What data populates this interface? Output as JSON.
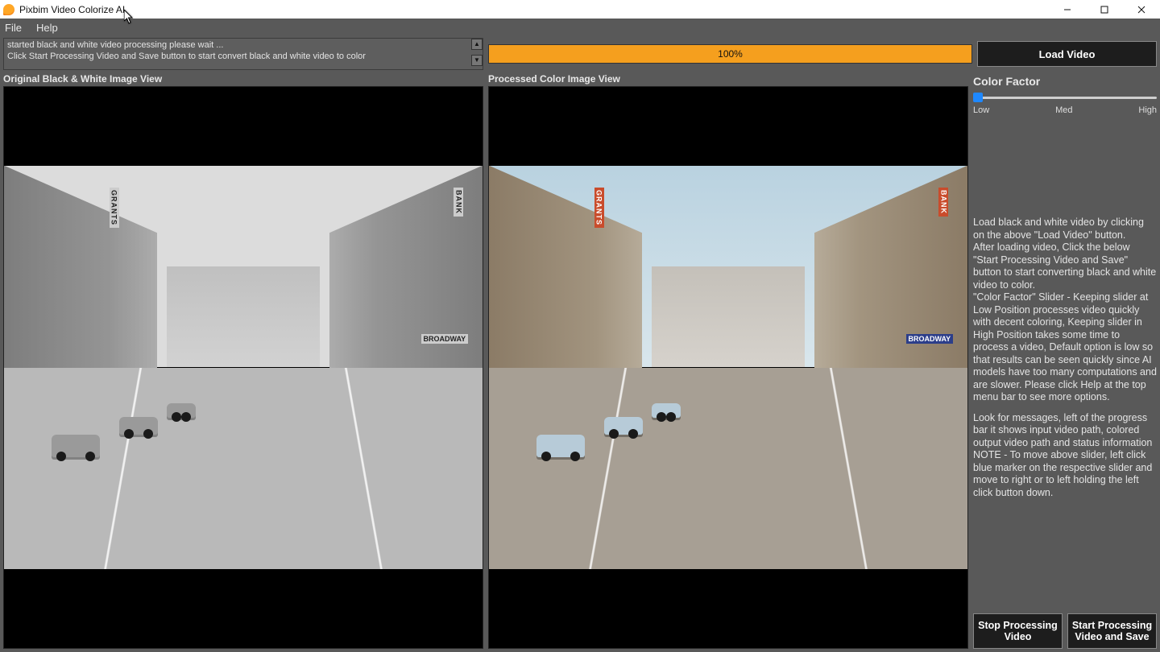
{
  "window": {
    "title": "Pixbim Video Colorize AI"
  },
  "menubar": {
    "file": "File",
    "help": "Help"
  },
  "log": {
    "line1": "started black and white video processing please wait ...",
    "line2": "Click Start Processing Video and Save button to start convert black and white video to color"
  },
  "progress": {
    "text": "100%",
    "percent": 100
  },
  "buttons": {
    "load": "Load Video",
    "stop": "Stop Processing Video",
    "start": "Start Processing Video and Save"
  },
  "labels": {
    "original": "Original Black & White  Image View",
    "processed": "Processed Color Image View"
  },
  "slider": {
    "heading": "Color Factor",
    "low": "Low",
    "med": "Med",
    "high": "High"
  },
  "help": {
    "p1": "Load black and white video by clicking on the above \"Load Video\" button.",
    "p2": "After loading video, Click the below \"Start Processing Video and Save\" button to start converting black and white video to color.",
    "p3": "\"Color Factor\" Slider - Keeping slider at Low Position processes video quickly with decent coloring, Keeping slider in High Position takes some time to process a video, Default option is low so that results can be seen quickly since AI models have too many computations and are slower. Please click Help at the top menu bar to see more options.",
    "p4": "Look for messages, left of the progress bar it shows input video path, colored output video path and status information",
    "p5": "NOTE - To move above slider, left click blue marker on the respective slider and move to right or to left holding the left click button down."
  },
  "scene_signs": {
    "broadway": "BROADWAY",
    "bank": "BANK",
    "grants": "GRANTS"
  }
}
